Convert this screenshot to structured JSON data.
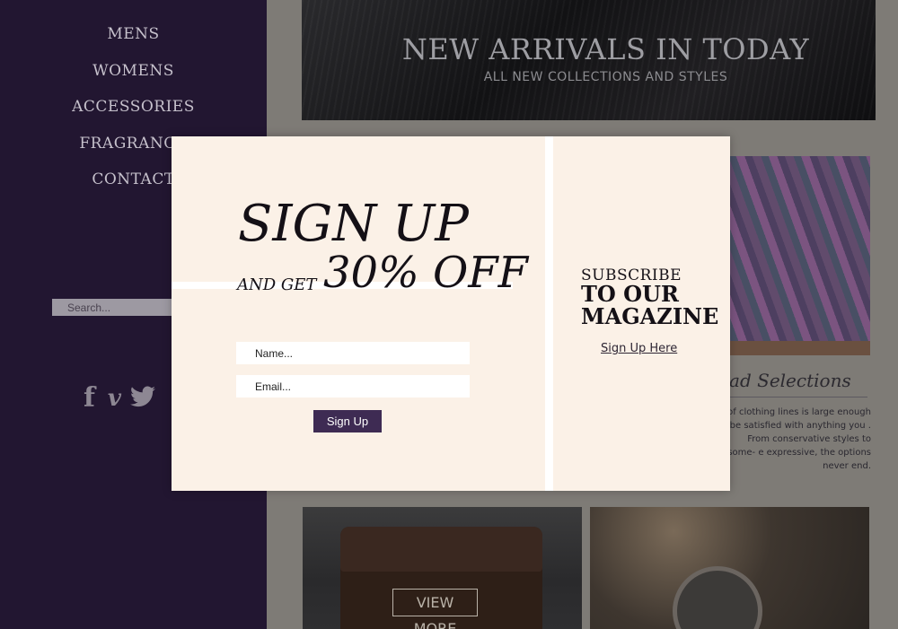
{
  "sidebar": {
    "nav": [
      {
        "label": "MENS"
      },
      {
        "label": "WOMENS"
      },
      {
        "label": "ACCESSORIES"
      },
      {
        "label": "FRAGRANCE"
      },
      {
        "label": "CONTACT"
      }
    ],
    "search": {
      "placeholder": "Search..."
    },
    "social": {
      "facebook": "f",
      "vine": "v",
      "twitter": "🐦"
    }
  },
  "hero": {
    "title": "NEW ARRIVALS IN TODAY",
    "subtitle": "ALL NEW COLLECTIONS  AND STYLES"
  },
  "selection": {
    "title": "oad Selections",
    "body": "y of clothing lines is large enough be satisfied with anything you . From conservative styles to some- e expressive, the options never end."
  },
  "tiles": {
    "view_more": "VIEW MORE"
  },
  "popup": {
    "title": "SIGN UP",
    "and_get": "AND GET",
    "discount": "30% OFF",
    "name_placeholder": "Name...",
    "email_placeholder": "Email...",
    "signup_button": "Sign Up",
    "subscribe_line1": "SUBSCRIBE",
    "subscribe_line2": "TO OUR",
    "subscribe_line3": "MAGAZINE",
    "subscribe_link": "Sign Up Here"
  },
  "colors": {
    "sidebar_bg": "#221631",
    "popup_bg": "#fbf1e7",
    "accent": "#3e2b53"
  }
}
